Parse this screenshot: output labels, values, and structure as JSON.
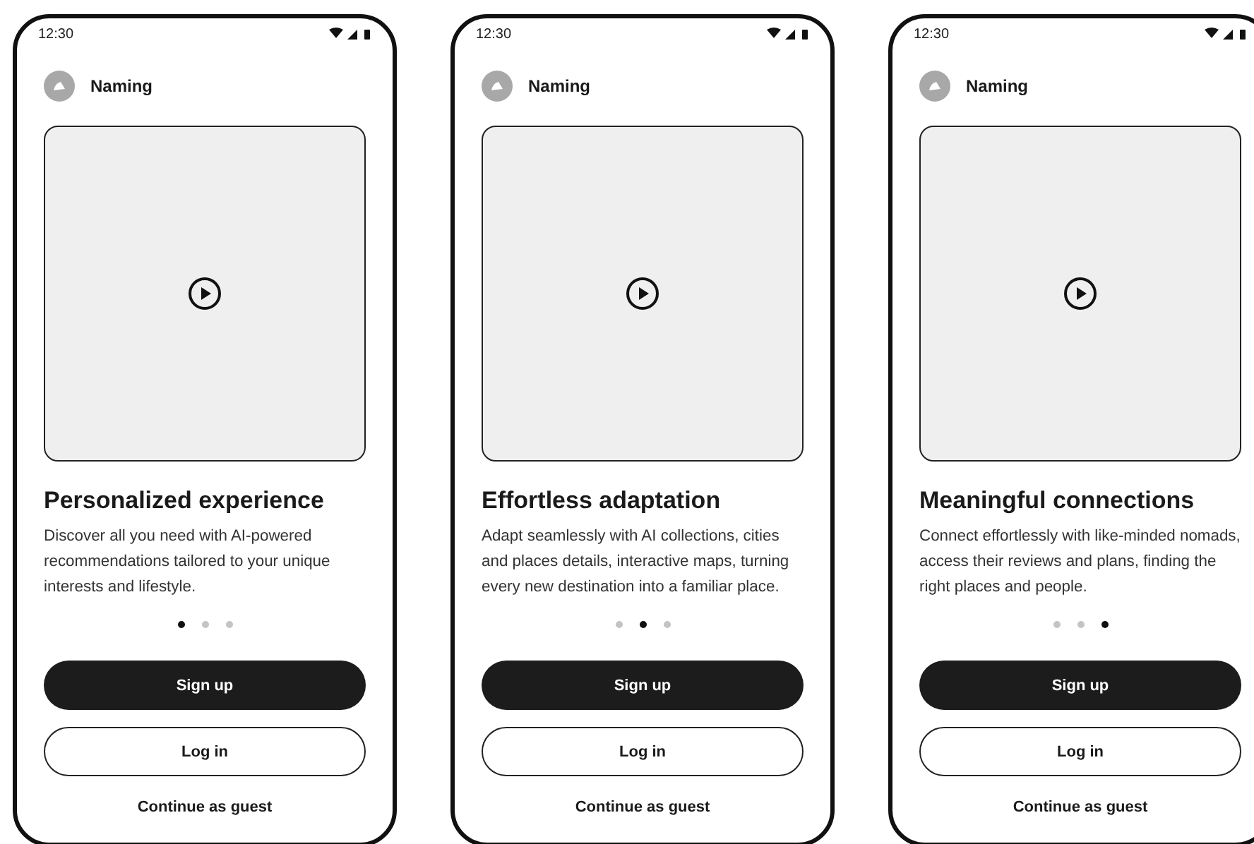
{
  "screens": [
    {
      "time": "12:30",
      "app_name": "Naming",
      "media": {
        "kind": "video"
      },
      "title": "Personalized experience",
      "description": "Discover all you need with AI-powered recommendations tailored to your unique interests and lifestyle.",
      "pages": [
        {
          "selected": true
        },
        {
          "selected": false
        },
        {
          "selected": false
        }
      ],
      "buttons": [
        {
          "kind": "primary",
          "label": "Sign up"
        },
        {
          "kind": "outline",
          "label": "Log in"
        },
        {
          "kind": "text",
          "label": "Continue as guest"
        }
      ]
    },
    {
      "time": "12:30",
      "app_name": "Naming",
      "media": {
        "kind": "video"
      },
      "title": "Effortless adaptation",
      "description": "Adapt seamlessly with AI collections, cities and places details, interactive maps, turning every new destination into a familiar place.",
      "pages": [
        {
          "selected": false
        },
        {
          "selected": true
        },
        {
          "selected": false
        }
      ],
      "buttons": [
        {
          "kind": "primary",
          "label": "Sign up"
        },
        {
          "kind": "outline",
          "label": "Log in"
        },
        {
          "kind": "text",
          "label": "Continue as guest"
        }
      ]
    },
    {
      "time": "12:30",
      "app_name": "Naming",
      "media": {
        "kind": "video"
      },
      "title": "Meaningful connections",
      "description": "Connect effortlessly with like-minded nomads, access their reviews and plans, finding the right places and people.",
      "pages": [
        {
          "selected": false
        },
        {
          "selected": false
        },
        {
          "selected": true
        }
      ],
      "buttons": [
        {
          "kind": "primary",
          "label": "Sign up"
        },
        {
          "kind": "outline",
          "label": "Log in"
        },
        {
          "kind": "text",
          "label": "Continue as guest"
        }
      ]
    }
  ]
}
